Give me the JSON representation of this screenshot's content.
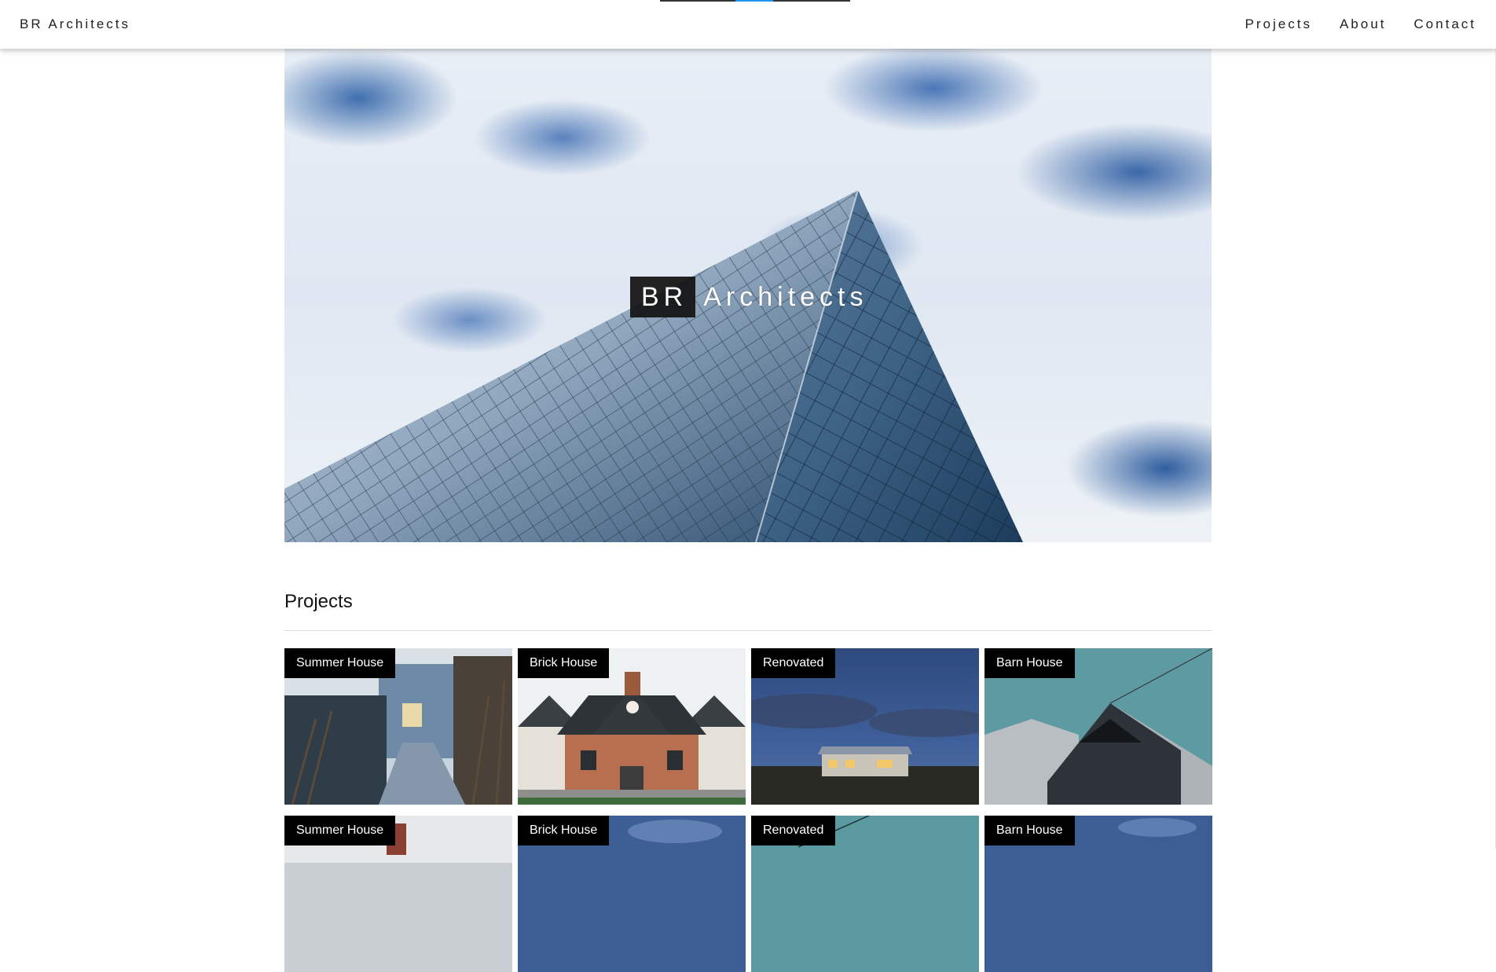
{
  "header": {
    "brand": "BR Architects",
    "nav": [
      "Projects",
      "About",
      "Contact"
    ]
  },
  "hero": {
    "title_box": "BR",
    "title_rest": "Architects"
  },
  "projects": {
    "heading": "Projects",
    "cards": [
      {
        "label": "Summer House"
      },
      {
        "label": "Brick House"
      },
      {
        "label": "Renovated"
      },
      {
        "label": "Barn House"
      },
      {
        "label": "Summer House"
      },
      {
        "label": "Brick House"
      },
      {
        "label": "Renovated"
      },
      {
        "label": "Barn House"
      }
    ]
  },
  "colors": {
    "nav_bg": "#ffffff",
    "text": "#222222",
    "label_bg": "#000000",
    "accent": "#2196F3"
  }
}
